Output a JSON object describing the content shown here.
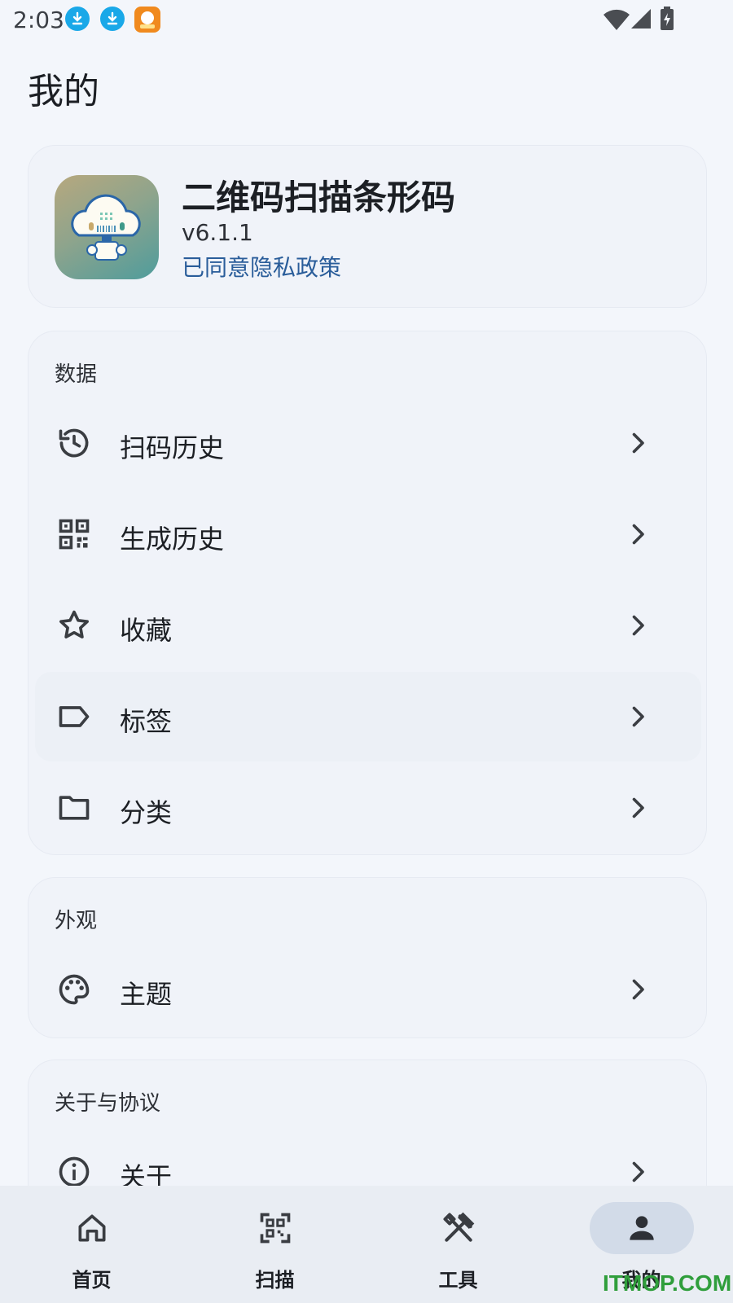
{
  "status_bar": {
    "time": "2:03"
  },
  "page": {
    "title": "我的"
  },
  "profile": {
    "app_name": "二维码扫描条形码",
    "version": "v6.1.1",
    "privacy": "已同意隐私政策"
  },
  "sections": {
    "data": {
      "title": "数据",
      "items": [
        {
          "label": "扫码历史",
          "icon": "history-icon"
        },
        {
          "label": "生成历史",
          "icon": "qr-code-icon"
        },
        {
          "label": "收藏",
          "icon": "star-icon"
        },
        {
          "label": "标签",
          "icon": "label-icon"
        },
        {
          "label": "分类",
          "icon": "folder-icon"
        }
      ]
    },
    "appearance": {
      "title": "外观",
      "items": [
        {
          "label": "主题",
          "icon": "palette-icon"
        }
      ]
    },
    "about": {
      "title": "关于与协议",
      "items": [
        {
          "label": "关于",
          "icon": "info-icon"
        }
      ]
    }
  },
  "bottom_nav": [
    {
      "label": "首页",
      "icon": "home-icon"
    },
    {
      "label": "扫描",
      "icon": "scan-icon"
    },
    {
      "label": "工具",
      "icon": "tools-icon"
    },
    {
      "label": "我的",
      "icon": "person-icon",
      "active": true
    }
  ],
  "watermark": "ITMOP.COM",
  "colors": {
    "accent_link": "#2a5d9a",
    "active_pill": "#d2dbe8",
    "background": "#f3f6fb"
  }
}
